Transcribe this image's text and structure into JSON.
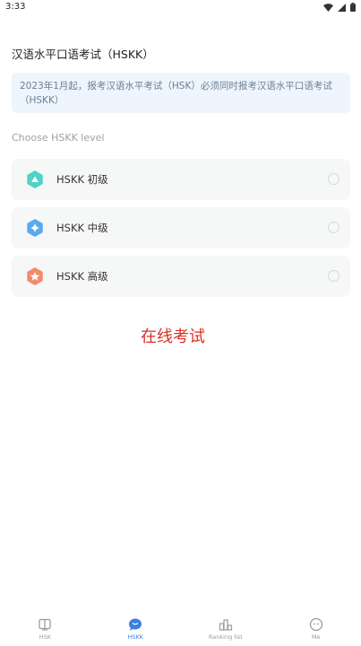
{
  "status_bar": {
    "time": "3:33"
  },
  "page": {
    "title": "汉语水平口语考试（HSKK）"
  },
  "notice": {
    "text": "2023年1月起，报考汉语水平考试（HSK）必须同时报考汉语水平口语考试（HSKK）"
  },
  "section": {
    "label": "Choose HSKK level"
  },
  "levels": [
    {
      "name": "HSKK 初级",
      "icon": "triangle-badge-icon",
      "color": "#4fd3c4"
    },
    {
      "name": "HSKK 中级",
      "icon": "diamond-badge-icon",
      "color": "#5aa9ef"
    },
    {
      "name": "HSKK 高级",
      "icon": "star-badge-icon",
      "color": "#f28c6b"
    }
  ],
  "overlay": {
    "text": "在线考试"
  },
  "tabbar": {
    "items": [
      {
        "label": "HSK",
        "icon": "book-icon",
        "active": false
      },
      {
        "label": "HSKK",
        "icon": "chat-bubble-icon",
        "active": true
      },
      {
        "label": "Ranking list",
        "icon": "ranking-icon",
        "active": false
      },
      {
        "label": "Me",
        "icon": "face-icon",
        "active": false
      }
    ],
    "active_color": "#3b7fe0"
  }
}
